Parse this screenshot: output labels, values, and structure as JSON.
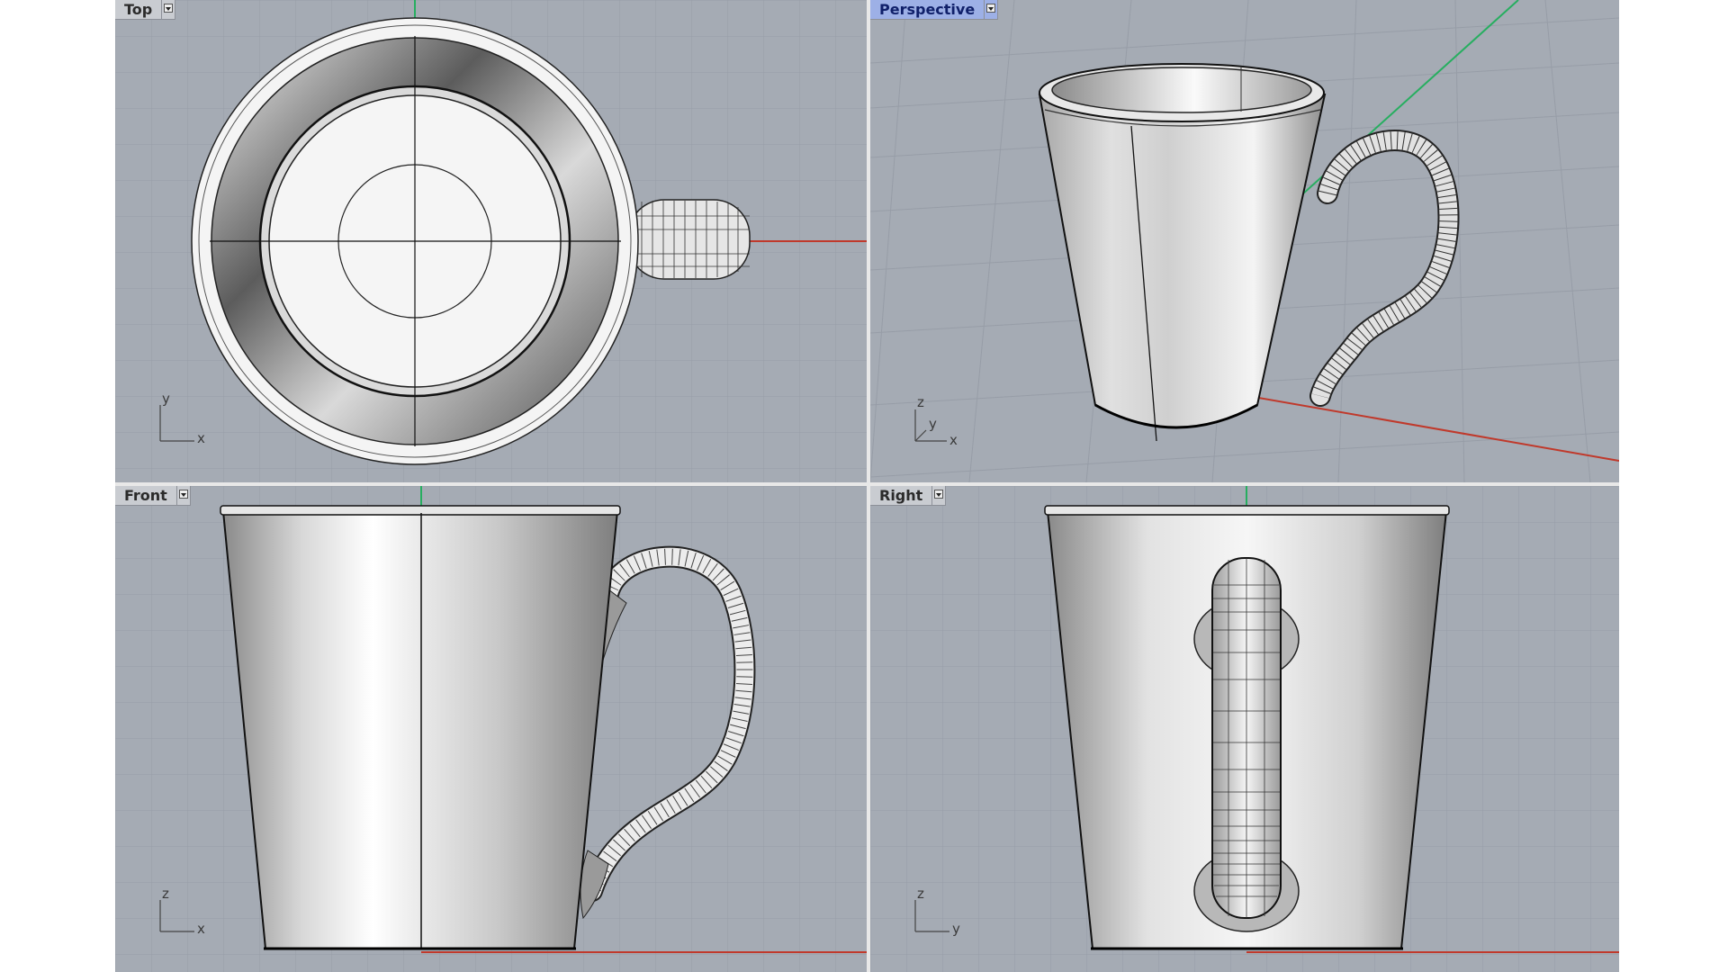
{
  "viewports": {
    "top": {
      "label": "Top",
      "axes": {
        "a": "y",
        "b": "x"
      }
    },
    "perspective": {
      "label": "Perspective",
      "axes": {
        "a": "z",
        "b": "y",
        "c": "x"
      }
    },
    "front": {
      "label": "Front",
      "axes": {
        "a": "z",
        "b": "x"
      }
    },
    "right": {
      "label": "Right",
      "axes": {
        "a": "z",
        "b": "y"
      }
    }
  },
  "colors": {
    "viewport_bg": "#a5abb4",
    "grid": "#9aa0a9",
    "x_axis": "#c0392b",
    "y_axis": "#27ae60",
    "active_label": "#9db0e6"
  },
  "active_viewport": "perspective"
}
